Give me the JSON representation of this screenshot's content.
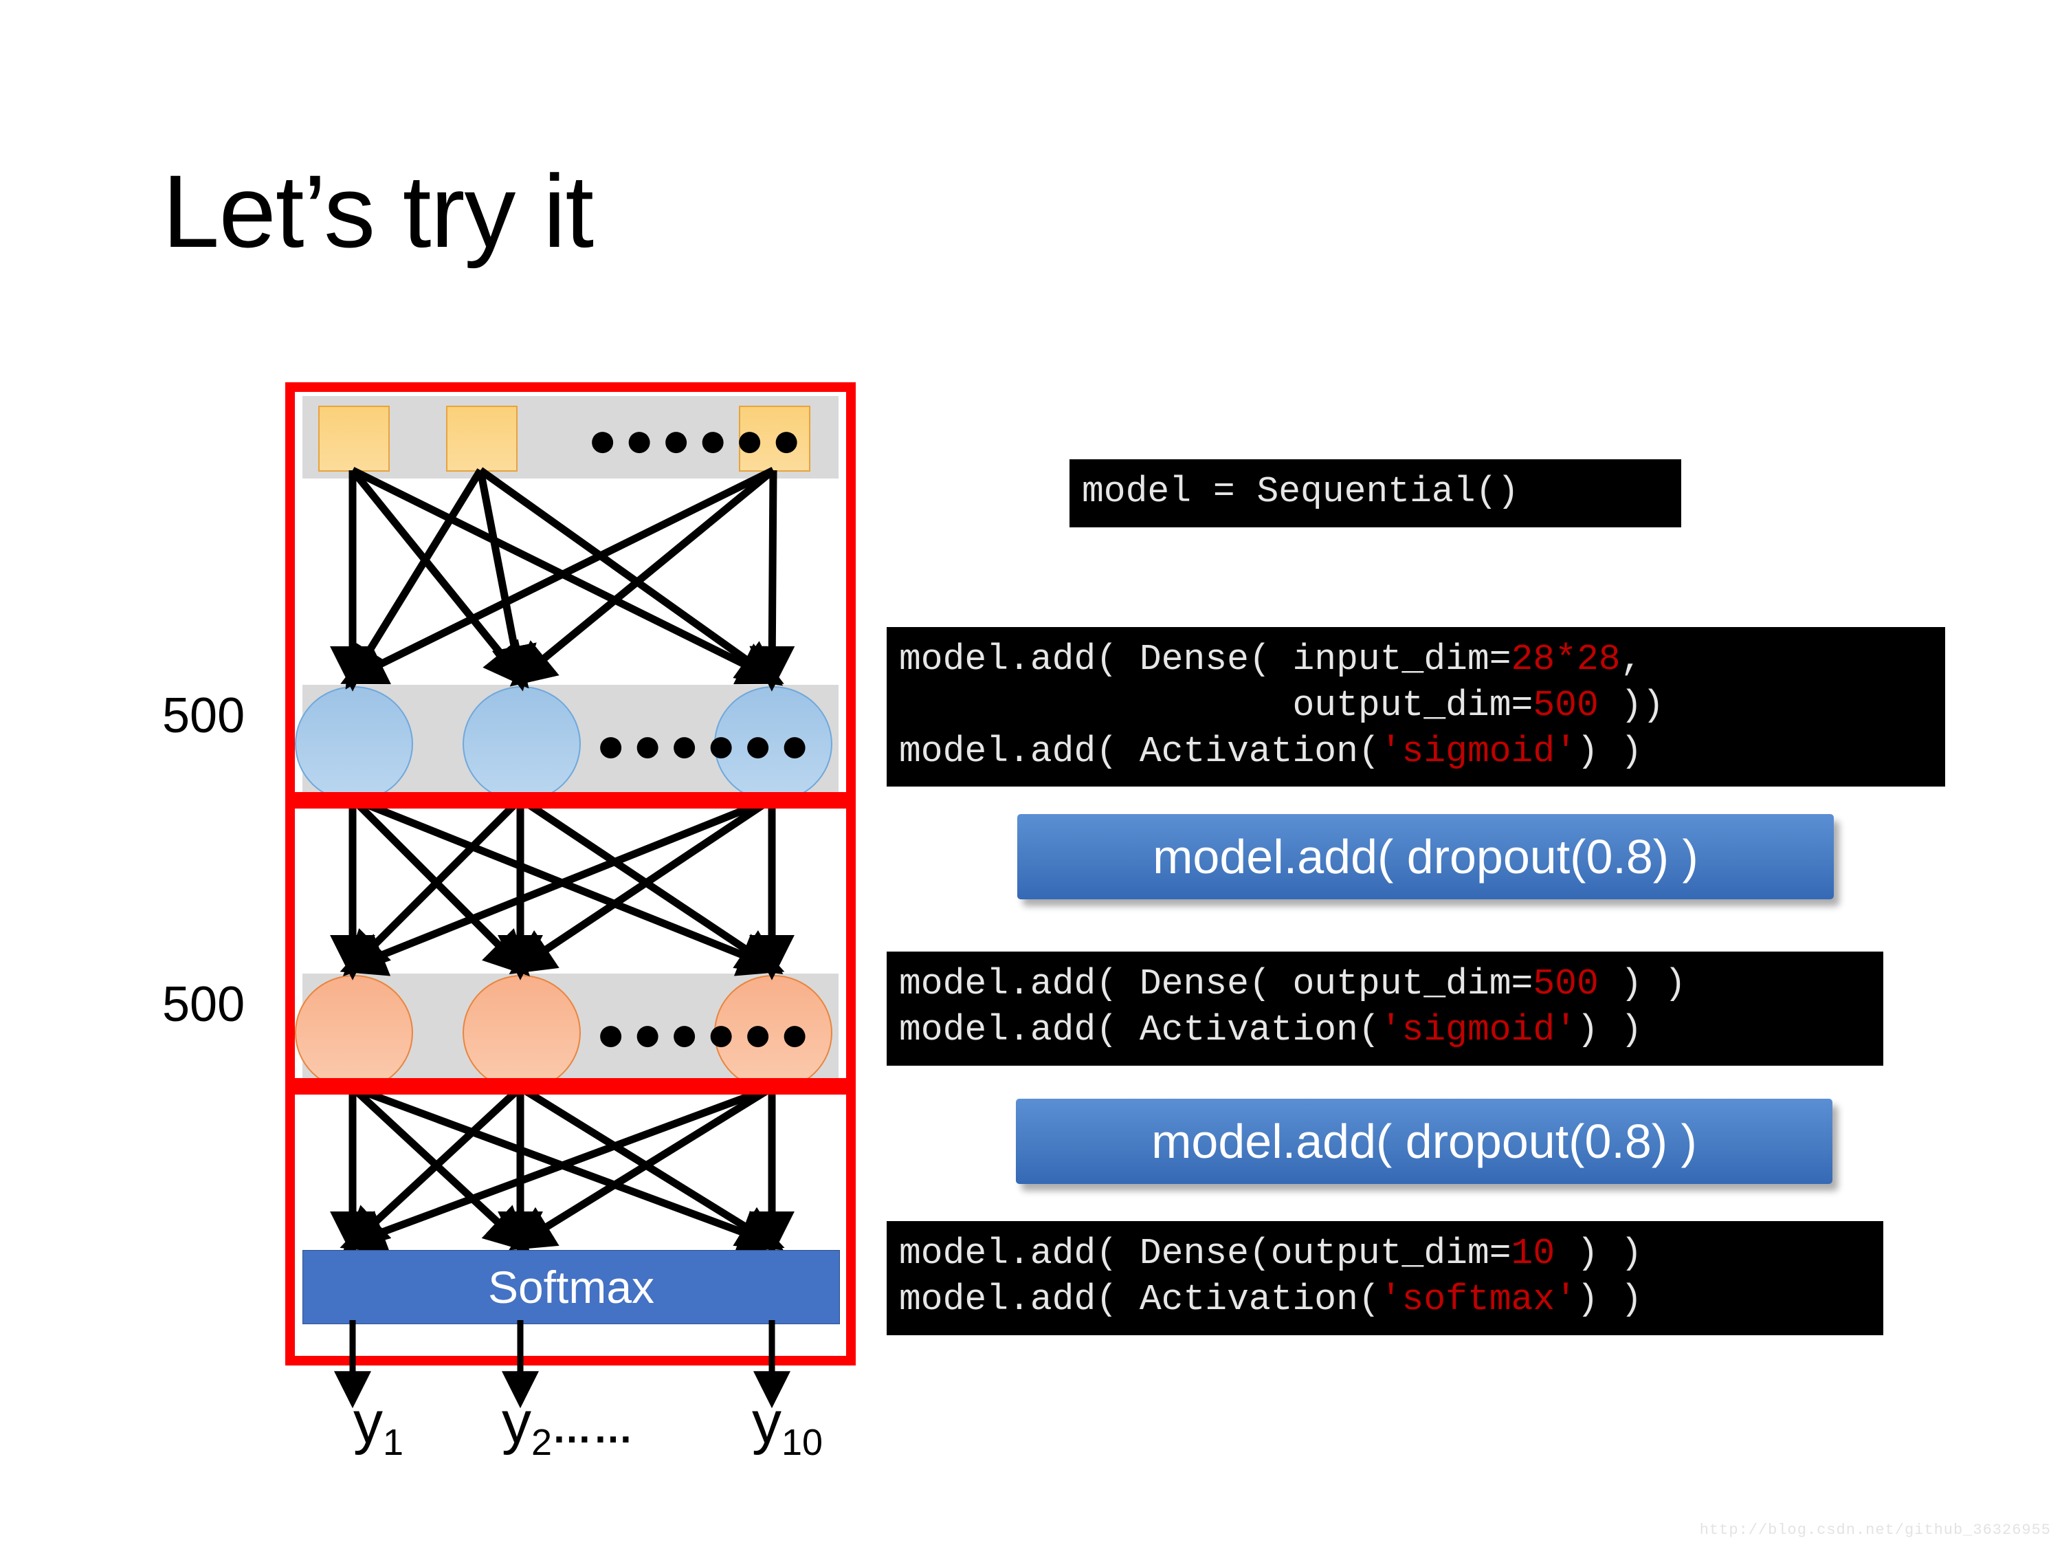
{
  "slide": {
    "title": "Let’s try it",
    "watermark": "http://blog.csdn.net/github_36326955"
  },
  "diagram": {
    "softmax_label": "Softmax",
    "layer_size_label_1": "500",
    "layer_size_label_2": "500",
    "ellipsis": "●●●●●●",
    "outputs": [
      {
        "base": "y",
        "sub": "1",
        "trailing": ""
      },
      {
        "base": "y",
        "sub": "2",
        "trailing": "……"
      },
      {
        "base": "y",
        "sub": "10",
        "trailing": ""
      }
    ]
  },
  "code": {
    "sequential": {
      "lines": [
        [
          {
            "t": "model = Sequential()",
            "c": "plain"
          }
        ]
      ]
    },
    "dense_block_1": {
      "lines": [
        [
          {
            "t": "model.add( Dense( input_dim=",
            "c": "plain"
          },
          {
            "t": "28*28",
            "c": "red"
          },
          {
            "t": ",",
            "c": "plain"
          }
        ],
        [
          {
            "t": "                  output_dim=",
            "c": "plain"
          },
          {
            "t": "500",
            "c": "red"
          },
          {
            "t": " ))",
            "c": "plain"
          }
        ],
        [
          {
            "t": "model.add( Activation(",
            "c": "plain"
          },
          {
            "t": "'sigmoid'",
            "c": "red"
          },
          {
            "t": ") )",
            "c": "plain"
          }
        ]
      ]
    },
    "dense_block_2": {
      "lines": [
        [
          {
            "t": "model.add( Dense( output_dim=",
            "c": "plain"
          },
          {
            "t": "500",
            "c": "red"
          },
          {
            "t": " ) )",
            "c": "plain"
          }
        ],
        [
          {
            "t": "model.add( Activation(",
            "c": "plain"
          },
          {
            "t": "'sigmoid'",
            "c": "red"
          },
          {
            "t": ") )",
            "c": "plain"
          }
        ]
      ]
    },
    "dense_block_3": {
      "lines": [
        [
          {
            "t": "model.add( Dense(output_dim=",
            "c": "plain"
          },
          {
            "t": "10",
            "c": "red"
          },
          {
            "t": " ) )",
            "c": "plain"
          }
        ],
        [
          {
            "t": "model.add( Activation(",
            "c": "plain"
          },
          {
            "t": "'softmax'",
            "c": "red"
          },
          {
            "t": ") )",
            "c": "plain"
          }
        ]
      ]
    }
  },
  "dropout_buttons": [
    {
      "label": "model.add( dropout(0.8) )"
    },
    {
      "label": "model.add( dropout(0.8) )"
    }
  ],
  "colors": {
    "highlight_red": "#FF0000",
    "code_bg": "#000000",
    "code_fg": "#E6E6E6",
    "code_literal": "#C00000",
    "softmax_blue": "#4472C4",
    "dropout_blue": "#4A7EC4",
    "input_node": "#FBD17A",
    "hidden1_node": "#9DC3E6",
    "hidden2_node": "#F8B08A",
    "band_gray": "#D9D9D9"
  }
}
